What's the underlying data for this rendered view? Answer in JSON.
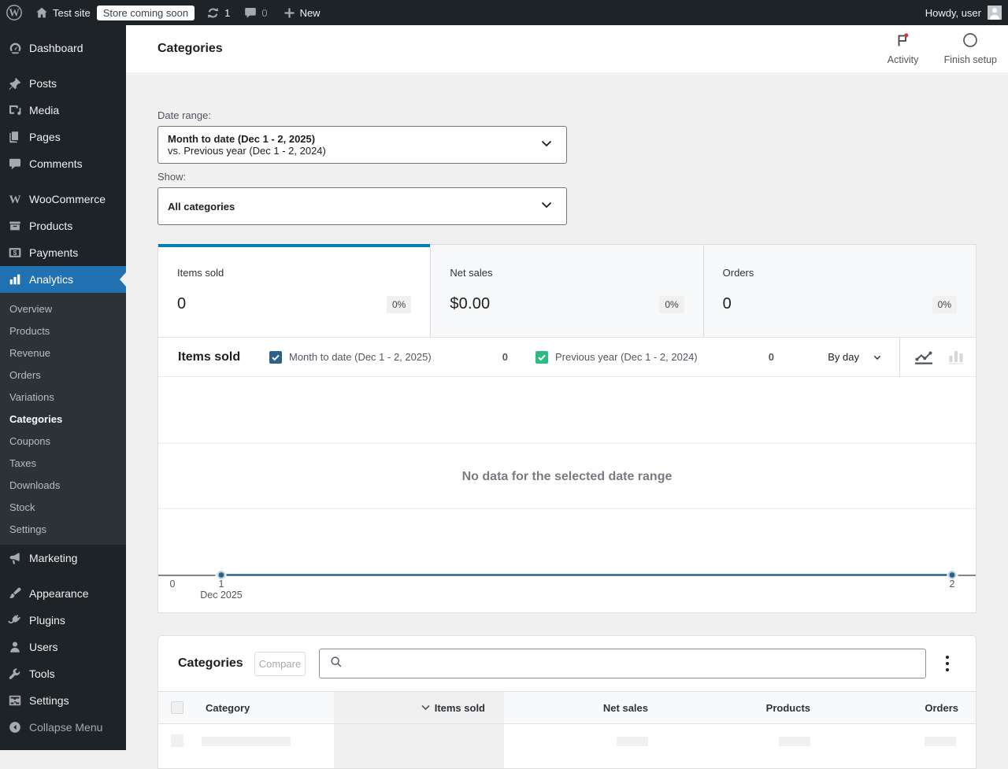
{
  "admin_bar": {
    "site_name": "Test site",
    "store_badge": "Store coming soon",
    "updates_count": "1",
    "comments_count": "0",
    "new_label": "New",
    "howdy": "Howdy, user"
  },
  "sidebar": {
    "menu": [
      {
        "label": "Dashboard"
      },
      {
        "label": "Posts"
      },
      {
        "label": "Media"
      },
      {
        "label": "Pages"
      },
      {
        "label": "Comments"
      },
      {
        "label": "WooCommerce"
      },
      {
        "label": "Products"
      },
      {
        "label": "Payments"
      },
      {
        "label": "Analytics"
      },
      {
        "label": "Marketing"
      },
      {
        "label": "Appearance"
      },
      {
        "label": "Plugins"
      },
      {
        "label": "Users"
      },
      {
        "label": "Tools"
      },
      {
        "label": "Settings"
      }
    ],
    "analytics_submenu": [
      {
        "label": "Overview"
      },
      {
        "label": "Products"
      },
      {
        "label": "Revenue"
      },
      {
        "label": "Orders"
      },
      {
        "label": "Variations"
      },
      {
        "label": "Categories",
        "current": true
      },
      {
        "label": "Coupons"
      },
      {
        "label": "Taxes"
      },
      {
        "label": "Downloads"
      },
      {
        "label": "Stock"
      },
      {
        "label": "Settings"
      }
    ],
    "collapse_label": "Collapse Menu"
  },
  "header": {
    "title": "Categories",
    "activity_label": "Activity",
    "finish_setup_label": "Finish setup"
  },
  "filters": {
    "date_range_label": "Date range:",
    "date_range_value": "Month to date (Dec 1 - 2, 2025)",
    "date_range_compare": "vs. Previous year (Dec 1 - 2, 2024)",
    "show_label": "Show:",
    "show_value": "All categories"
  },
  "summary": {
    "tiles": [
      {
        "label": "Items sold",
        "value": "0",
        "delta": "0%"
      },
      {
        "label": "Net sales",
        "value": "$0.00",
        "delta": "0%"
      },
      {
        "label": "Orders",
        "value": "0",
        "delta": "0%"
      }
    ]
  },
  "chart": {
    "title": "Items sold",
    "legend": [
      {
        "label": "Month to date (Dec 1 - 2, 2025)",
        "value": "0"
      },
      {
        "label": "Previous year (Dec 1 - 2, 2024)",
        "value": "0"
      }
    ],
    "interval_label": "By day",
    "empty_message": "No data for the selected date range",
    "tick_0": "0",
    "tick_1": "1",
    "tick_2": "2",
    "axis_note": "Dec 2025"
  },
  "chart_data": {
    "type": "line",
    "title": "Items sold",
    "x": [
      1,
      2
    ],
    "x_tick_labels": [
      "0",
      "1",
      "2"
    ],
    "xlabel": "Dec 2025",
    "series": [
      {
        "name": "Month to date (Dec 1 - 2, 2025)",
        "values": [
          0,
          0
        ],
        "color": "#2c6288"
      },
      {
        "name": "Previous year (Dec 1 - 2, 2024)",
        "values": [
          0,
          0
        ],
        "color": "#2dbc7f"
      }
    ],
    "ylim": [
      0,
      3
    ],
    "grid": true,
    "legend_position": "top",
    "empty_message": "No data for the selected date range"
  },
  "table": {
    "title": "Categories",
    "compare_label": "Compare",
    "search_placeholder": "",
    "columns": [
      "Category",
      "Items sold",
      "Net sales",
      "Products",
      "Orders"
    ],
    "sorted_column": "Items sold",
    "sort_direction": "desc"
  },
  "colors": {
    "menu_active": "#2271b1",
    "tile_highlight": "#007cba",
    "chart_blue": "#2c6288",
    "chart_green": "#2dbc7f",
    "notification_red": "#d63638",
    "admin_bar_bg": "#1d2327",
    "submenu_bg": "#2c3338",
    "content_bg": "#f0f0f1"
  }
}
